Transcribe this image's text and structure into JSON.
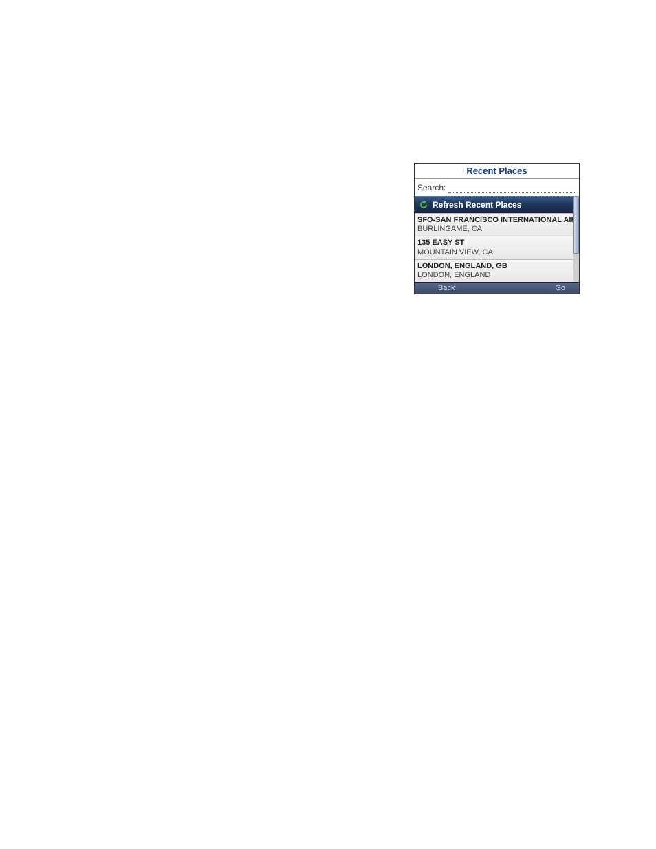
{
  "title": "Recent Places",
  "search": {
    "label": "Search:",
    "value": ""
  },
  "refresh_label": "Refresh Recent Places",
  "places": [
    {
      "title": "SFO-SAN FRANCISCO INTERNATIONAL AIRPOR",
      "subtitle": "BURLINGAME, CA"
    },
    {
      "title": "135 EASY ST",
      "subtitle": "MOUNTAIN VIEW, CA"
    },
    {
      "title": "LONDON, ENGLAND, GB",
      "subtitle": "LONDON, ENGLAND"
    }
  ],
  "buttons": {
    "back": "Back",
    "go": "Go"
  }
}
